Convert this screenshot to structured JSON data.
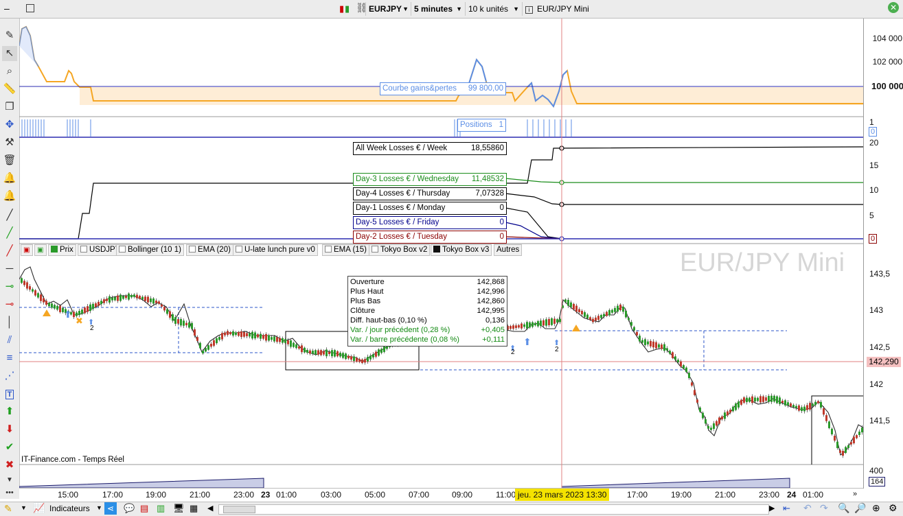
{
  "toolbar": {
    "symbol": "EURJPY",
    "timeframe": "5 minutes",
    "units": "10 k unités",
    "instrument": "EUR/JPY Mini"
  },
  "equity_panel": {
    "label": "Courbe gains&pertes",
    "value": "99 800,00",
    "y_ticks": [
      "104 000",
      "102 000",
      "100 000"
    ]
  },
  "positions_panel": {
    "label": "Positions",
    "value": "1",
    "y_ticks": [
      "1",
      "0"
    ]
  },
  "losses_panel": {
    "y_ticks": [
      "20",
      "15",
      "10",
      "5",
      "0"
    ],
    "series": [
      {
        "name": "All Week Losses € / Week",
        "value": "18,55860",
        "color": "#000000"
      },
      {
        "name": "Day-3 Losses € / Wednesday",
        "value": "11,48532",
        "color": "#1a8c1a"
      },
      {
        "name": "Day-4 Losses € / Thursday",
        "value": "7,07328",
        "color": "#000000"
      },
      {
        "name": "Day-1 Losses € / Monday",
        "value": "0",
        "color": "#000000"
      },
      {
        "name": "Day-5 Losses € / Friday",
        "value": "0",
        "color": "#00008b"
      },
      {
        "name": "Day-2 Losses € / Tuesday",
        "value": "0",
        "color": "#8b0000"
      }
    ]
  },
  "indicator_tabs": [
    "Prix",
    "USDJPY",
    "Bollinger (10 1)",
    "EMA (20)",
    "U-late lunch pure v0",
    "EMA (15)",
    "Tokyo Box v2",
    "Tokyo Box v3",
    "Autres"
  ],
  "price_panel": {
    "watermark": "EUR/JPY Mini",
    "source": "IT-Finance.com - Temps Réel",
    "y_ticks": [
      "143,5",
      "143",
      "142,5",
      "142",
      "141,5"
    ],
    "current_price": "142,290",
    "ohlc": [
      {
        "label": "Ouverture",
        "value": "142,868"
      },
      {
        "label": "Plus Haut",
        "value": "142,996"
      },
      {
        "label": "Plus Bas",
        "value": "142,860"
      },
      {
        "label": "Clôture",
        "value": "142,995"
      },
      {
        "label": "Diff. haut-bas (0,10 %)",
        "value": "0,136"
      },
      {
        "label": "Var. / jour précédent (0,28 %)",
        "value": "+0,405"
      },
      {
        "label": "Var. / barre précédente (0,08 %)",
        "value": "+0,111"
      }
    ],
    "marker_labels": [
      "2",
      "2",
      "2"
    ]
  },
  "volume_panel": {
    "y_ticks": [
      "400",
      "164"
    ]
  },
  "time_axis": {
    "ticks": [
      "15:00",
      "17:00",
      "19:00",
      "21:00",
      "23:00",
      "23",
      "01:00",
      "03:00",
      "05:00",
      "07:00",
      "09:00",
      "11:00",
      "17:00",
      "19:00",
      "21:00",
      "23:00",
      "24",
      "01:00"
    ],
    "cursor": "jeu. 23 mars 2023 13:30"
  },
  "bottom_toolbar": {
    "indicators_label": "Indicateurs"
  },
  "colors": {
    "equity": "#f5a623",
    "equity_up": "#5b8ee6",
    "candle_up": "#2a9a2a",
    "candle_down": "#c0392b",
    "cursor": "#e08080",
    "accent": "#2b56c9"
  }
}
